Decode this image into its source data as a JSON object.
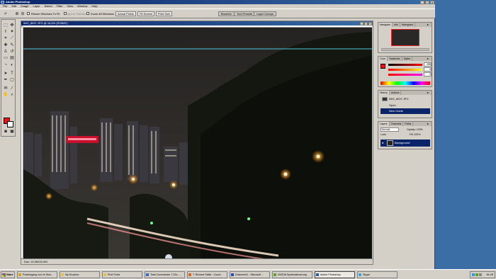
{
  "app": {
    "title": "Adobe Photoshop",
    "window_buttons": [
      "_",
      "□",
      "×"
    ]
  },
  "menu": [
    "File",
    "Edit",
    "Image",
    "Layer",
    "Select",
    "Filter",
    "View",
    "Window",
    "Help"
  ],
  "options_bar": {
    "resize_windows_label": "Resize Windows To Fit",
    "ignore_palettes_label": "Ignore Palettes",
    "zoom_all_label": "Zoom All Windows",
    "actual_pixels": "Actual Pixels",
    "fit_screen": "Fit Screen",
    "print_size": "Print Size",
    "well_tabs": [
      "Brushes",
      "Tool Presets",
      "Layer Comps"
    ]
  },
  "document": {
    "title": "IMG_8037.JPG @ 16,6% (RGB/8*)",
    "status": "Doc: 22,9M/22,9M"
  },
  "palettes": {
    "navigator_tabs": [
      "Navigator",
      "Info",
      "Histogram"
    ],
    "color_tabs": [
      "Color",
      "Swatches",
      "Styles"
    ],
    "color_values": [
      "255",
      "0",
      "0"
    ],
    "history_tabs": [
      "History",
      "Actions"
    ],
    "history_items": [
      "IMG_8037.JPG",
      "Open",
      "New Guide"
    ],
    "layers_tabs": [
      "Layers",
      "Channels",
      "Paths"
    ],
    "layers_mode": "Normal",
    "layers_opacity_label": "Opacity: 100%",
    "layers_fill_label": "Fill: 100%",
    "layers_lock_label": "Lock:",
    "layer_name": "Background"
  },
  "taskbar": {
    "start": "Start",
    "tasks": [
      "Posteingang von ve Stue...",
      "My Dropbox",
      "Pixel Tools",
      "Total Commander 7.02a -...",
      "T. Richard Sättle - Count...",
      "Dokument1 - Microsoft ...",
      "NVIDIA Systemsteuerung",
      "Adobe Photoshop",
      "Skype"
    ],
    "clock": "16:45"
  },
  "colors": {
    "title_blue": "#0a246a",
    "desktop": "#3a6ea5",
    "foreground_color": "#ee1111",
    "guide": "#4fc8e0"
  }
}
